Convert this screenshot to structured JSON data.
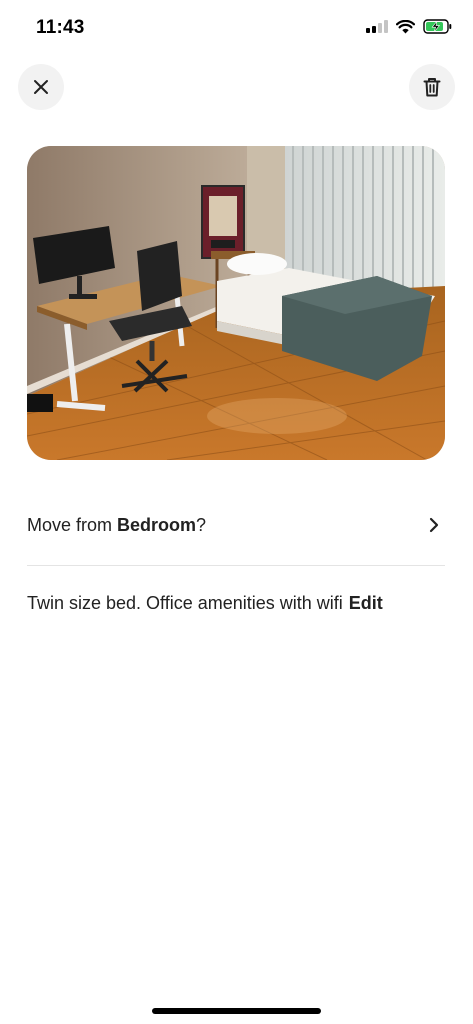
{
  "status_bar": {
    "time": "11:43",
    "battery_charging": true
  },
  "header": {
    "close_icon": "close-icon",
    "delete_icon": "trash-icon"
  },
  "photo": {
    "subject": "bedroom-photo"
  },
  "move_row": {
    "prefix": "Move from ",
    "room": "Bedroom",
    "suffix": "?",
    "chevron_icon": "chevron-right-icon"
  },
  "caption": {
    "text": "Twin size bed. Office amenities with wifi",
    "edit_label": "Edit"
  }
}
